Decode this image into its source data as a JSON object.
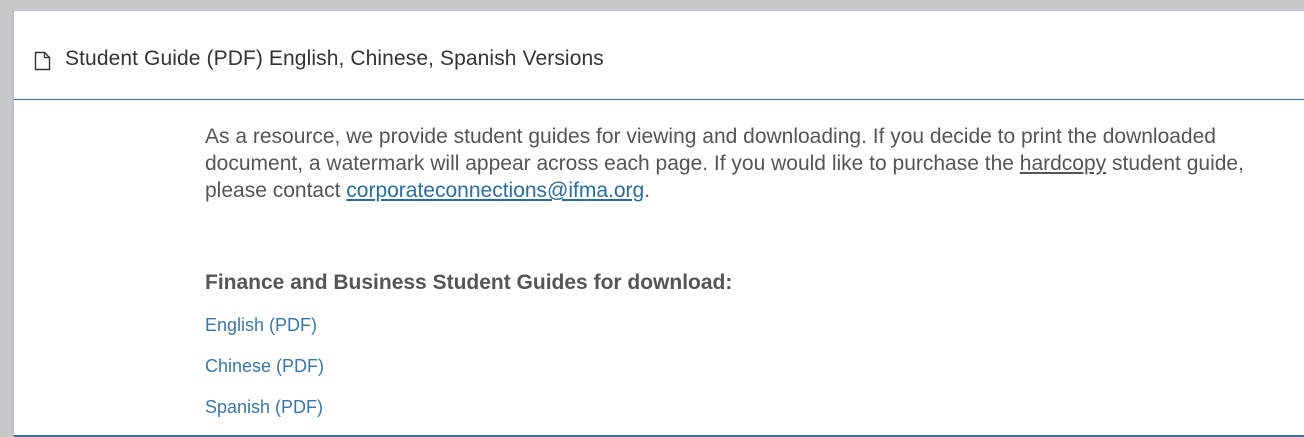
{
  "panel": {
    "title": "Student Guide (PDF) English, Chinese, Spanish Versions",
    "icon": "document-icon"
  },
  "intro": {
    "text_before": "As a resource, we provide student guides for viewing and downloading. If you decide to print the downloaded document, a watermark will appear across each page. If you would like to purchase the ",
    "underlined_word": "hardcopy",
    "text_middle": " student guide, please contact ",
    "email": "corporateconnections@ifma.org",
    "text_after": "."
  },
  "downloads": {
    "heading": "Finance and Business Student Guides for download:",
    "links": [
      {
        "label": "English (PDF)"
      },
      {
        "label": "Chinese (PDF)"
      },
      {
        "label": "Spanish (PDF)"
      }
    ]
  },
  "colors": {
    "link": "#3a77a8",
    "border_accent": "#3a6fa0",
    "text": "#555555"
  }
}
